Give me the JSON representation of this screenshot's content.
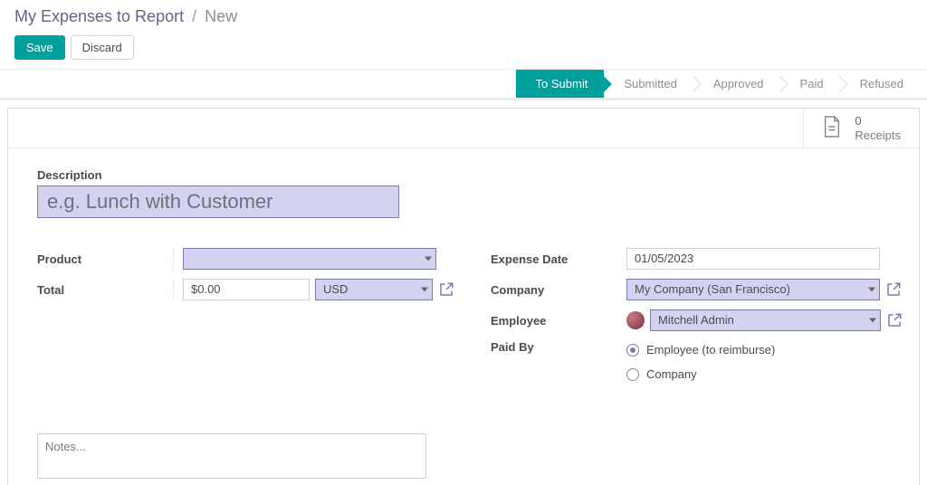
{
  "breadcrumb": {
    "parent": "My Expenses to Report",
    "current": "New"
  },
  "buttons": {
    "save": "Save",
    "discard": "Discard"
  },
  "stages": [
    "To Submit",
    "Submitted",
    "Approved",
    "Paid",
    "Refused"
  ],
  "active_stage": "To Submit",
  "receipts": {
    "count": "0",
    "label": "Receipts"
  },
  "labels": {
    "description": "Description",
    "product": "Product",
    "total": "Total",
    "expense_date": "Expense Date",
    "company": "Company",
    "employee": "Employee",
    "paid_by": "Paid By"
  },
  "fields": {
    "description_placeholder": "e.g. Lunch with Customer",
    "description_value": "",
    "product": "",
    "total_amount": "$0.00",
    "total_currency": "USD",
    "expense_date": "01/05/2023",
    "company": "My Company (San Francisco)",
    "employee": "Mitchell Admin",
    "paid_by_options": [
      "Employee (to reimburse)",
      "Company"
    ],
    "paid_by_selected": "Employee (to reimburse)",
    "notes_placeholder": "Notes...",
    "notes_value": ""
  }
}
